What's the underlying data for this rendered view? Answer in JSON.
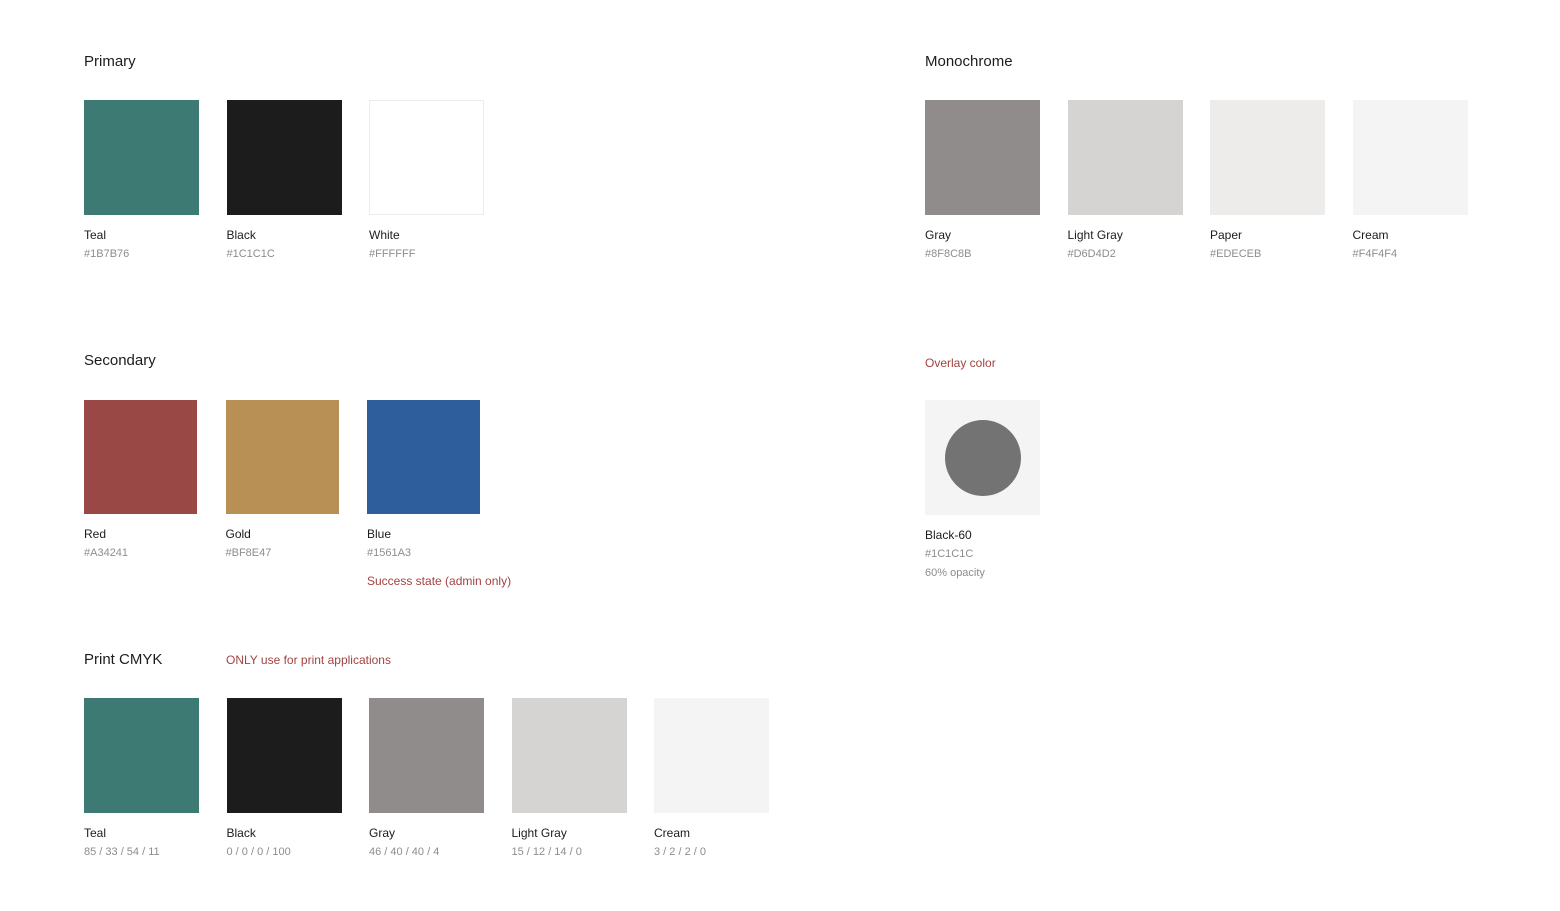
{
  "primary": {
    "title": "Primary",
    "swatches": [
      {
        "name": "Teal",
        "hex": "#1B7B76",
        "color": "#3d7a74"
      },
      {
        "name": "Black",
        "hex": "#1C1C1C",
        "color": "#1c1c1c"
      },
      {
        "name": "White",
        "hex": "#FFFFFF",
        "color": "#ffffff"
      }
    ]
  },
  "monochrome": {
    "title": "Monochrome",
    "swatches": [
      {
        "name": "Gray",
        "hex": "#8F8C8B",
        "color": "#8f8c8b"
      },
      {
        "name": "Light Gray",
        "hex": "#D6D4D2",
        "color": "#d6d4d2"
      },
      {
        "name": "Paper",
        "hex": "#EDECEB",
        "color": "#edeceb"
      },
      {
        "name": "Cream",
        "hex": "#F4F4F4",
        "color": "#f4f4f4"
      }
    ]
  },
  "secondary": {
    "title": "Secondary",
    "swatches": [
      {
        "name": "Red",
        "hex": "#A34241",
        "color": "#9a4846"
      },
      {
        "name": "Gold",
        "hex": "#BF8E47",
        "color": "#b89055"
      },
      {
        "name": "Blue",
        "hex": "#1561A3",
        "color": "#2e5f9c",
        "note": "Success state (admin only)"
      }
    ]
  },
  "overlay": {
    "title": "Overlay color",
    "name": "Black-60",
    "hex": "#1C1C1C",
    "opacity": "60% opacity"
  },
  "print_cmyk": {
    "title": "Print CMYK",
    "note": "ONLY use for print applications",
    "swatches": [
      {
        "name": "Teal",
        "cmyk": "85 / 33 / 54 / 11",
        "color": "#3d7a74"
      },
      {
        "name": "Black",
        "cmyk": "0 / 0 / 0 / 100",
        "color": "#1c1c1c"
      },
      {
        "name": "Gray",
        "cmyk": "46 / 40 / 40 / 4",
        "color": "#8f8c8b"
      },
      {
        "name": "Light Gray",
        "cmyk": "15 / 12 / 14 / 0",
        "color": "#d6d4d2"
      },
      {
        "name": "Cream",
        "cmyk": "3 / 2 / 2 / 0",
        "color": "#f4f4f4"
      }
    ]
  },
  "accent_note_color": "#A34241"
}
